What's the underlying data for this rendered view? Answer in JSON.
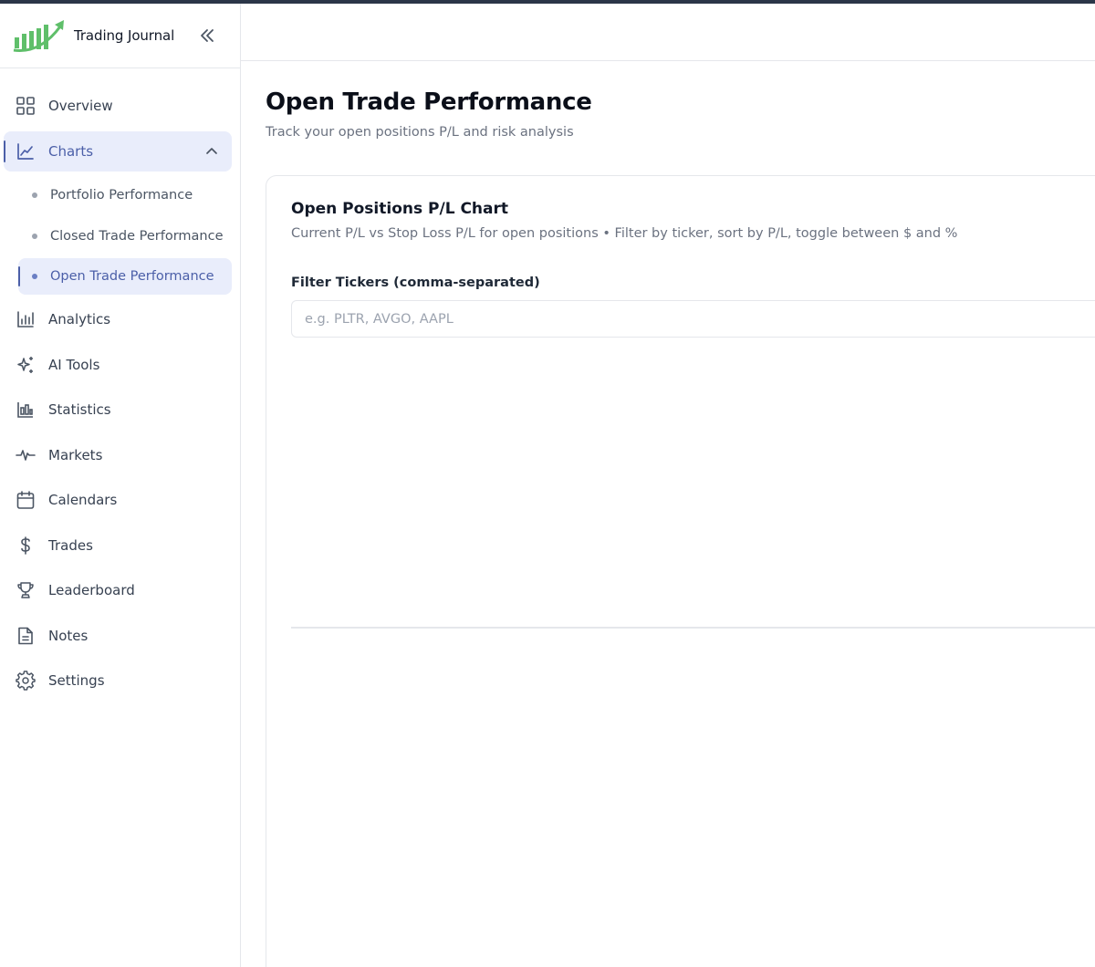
{
  "app": {
    "name": "Trading Journal",
    "brand_color": "#5fbf6a",
    "accent_color": "#4b5fa8"
  },
  "sidebar": {
    "collapse_icon": "double-chevron-left-icon",
    "items": [
      {
        "label": "Overview",
        "icon": "grid-icon"
      },
      {
        "label": "Charts",
        "icon": "line-chart-icon",
        "expanded": true
      },
      {
        "label": "Analytics",
        "icon": "bar-chart-icon"
      },
      {
        "label": "AI Tools",
        "icon": "sparkles-icon"
      },
      {
        "label": "Statistics",
        "icon": "statistics-icon"
      },
      {
        "label": "Markets",
        "icon": "pulse-icon"
      },
      {
        "label": "Calendars",
        "icon": "calendar-icon"
      },
      {
        "label": "Trades",
        "icon": "dollar-icon"
      },
      {
        "label": "Leaderboard",
        "icon": "trophy-icon"
      },
      {
        "label": "Notes",
        "icon": "note-icon"
      },
      {
        "label": "Settings",
        "icon": "gear-icon"
      }
    ],
    "charts_sub": [
      {
        "label": "Portfolio Performance"
      },
      {
        "label": "Closed Trade Performance"
      },
      {
        "label": "Open Trade Performance",
        "active": true
      }
    ]
  },
  "main": {
    "title": "Open Trade Performance",
    "subtitle": "Track your open positions P/L and risk analysis",
    "card": {
      "title": "Open Positions P/L Chart",
      "description": "Current P/L vs Stop Loss P/L for open positions • Filter by ticker, sort by P/L, toggle between $ and %",
      "filter_label": "Filter Tickers (comma-separated)",
      "filter_placeholder": "e.g. PLTR, AVGO, AAPL",
      "filter_value": ""
    }
  }
}
